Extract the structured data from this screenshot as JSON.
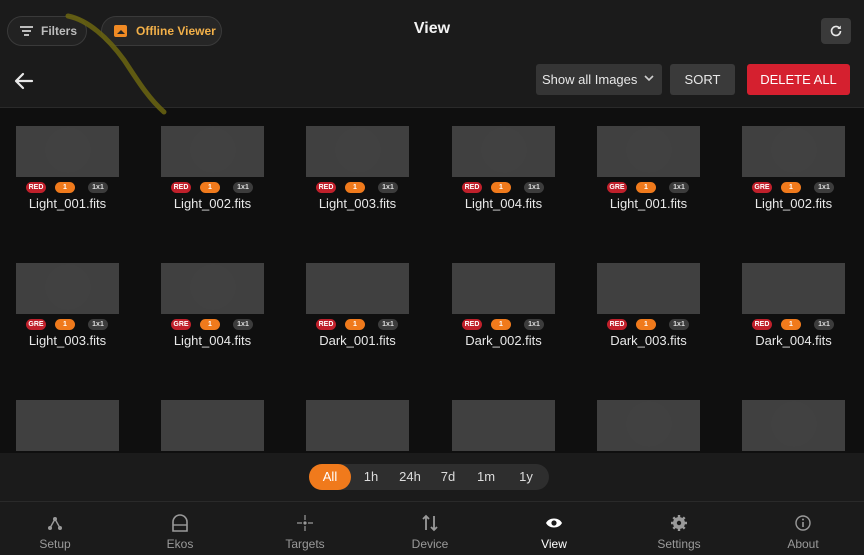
{
  "header": {
    "filters_label": "Filters",
    "offline_viewer_label": "Offline Viewer",
    "title": "View",
    "refresh_icon": "refresh-icon"
  },
  "actions": {
    "back_icon": "arrow-left-icon",
    "select_value": "Show all Images",
    "sort_label": "SORT",
    "delete_all_label": "DELETE ALL"
  },
  "colors": {
    "accent": "#f07a1c",
    "danger": "#d5202f",
    "filter_badge": "#c0202b",
    "offline_text": "#f2b049"
  },
  "images": [
    {
      "name": "Light_001.fits",
      "filter": "RED",
      "count": "1",
      "binning": "1x1",
      "disc": true
    },
    {
      "name": "Light_002.fits",
      "filter": "RED",
      "count": "1",
      "binning": "1x1",
      "disc": true
    },
    {
      "name": "Light_003.fits",
      "filter": "RED",
      "count": "1",
      "binning": "1x1",
      "disc": true
    },
    {
      "name": "Light_004.fits",
      "filter": "RED",
      "count": "1",
      "binning": "1x1",
      "disc": true
    },
    {
      "name": "Light_001.fits",
      "filter": "GRE",
      "count": "1",
      "binning": "1x1",
      "disc": true
    },
    {
      "name": "Light_002.fits",
      "filter": "GRE",
      "count": "1",
      "binning": "1x1",
      "disc": true
    },
    {
      "name": "Light_003.fits",
      "filter": "GRE",
      "count": "1",
      "binning": "1x1",
      "disc": true
    },
    {
      "name": "Light_004.fits",
      "filter": "GRE",
      "count": "1",
      "binning": "1x1",
      "disc": true
    },
    {
      "name": "Dark_001.fits",
      "filter": "RED",
      "count": "1",
      "binning": "1x1",
      "disc": false
    },
    {
      "name": "Dark_002.fits",
      "filter": "RED",
      "count": "1",
      "binning": "1x1",
      "disc": false
    },
    {
      "name": "Dark_003.fits",
      "filter": "RED",
      "count": "1",
      "binning": "1x1",
      "disc": false
    },
    {
      "name": "Dark_004.fits",
      "filter": "RED",
      "count": "1",
      "binning": "1x1",
      "disc": false
    },
    {
      "disc": false
    },
    {
      "disc": false
    },
    {
      "disc": false
    },
    {
      "disc": false
    },
    {
      "disc": true
    },
    {
      "disc": true
    }
  ],
  "time_filter": {
    "options": [
      "All",
      "1h",
      "24h",
      "7d",
      "1m",
      "1y"
    ],
    "selected": "All"
  },
  "bottom_nav": [
    {
      "label": "Setup",
      "icon": "setup-icon",
      "active": false
    },
    {
      "label": "Ekos",
      "icon": "ekos-icon",
      "active": false
    },
    {
      "label": "Targets",
      "icon": "targets-icon",
      "active": false
    },
    {
      "label": "Device",
      "icon": "device-icon",
      "active": false
    },
    {
      "label": "View",
      "icon": "eye-icon",
      "active": true
    },
    {
      "label": "Settings",
      "icon": "gear-icon",
      "active": false
    },
    {
      "label": "About",
      "icon": "info-icon",
      "active": false
    }
  ]
}
